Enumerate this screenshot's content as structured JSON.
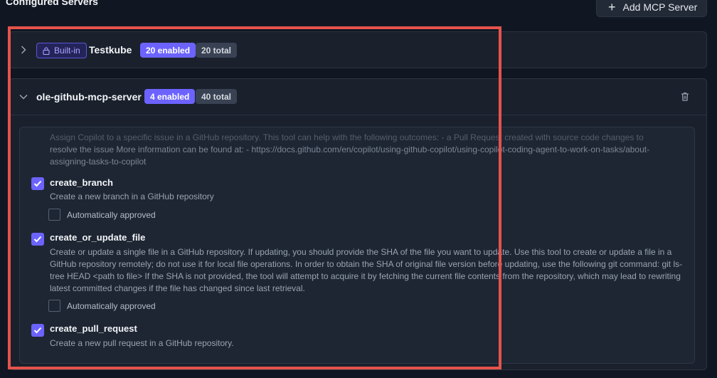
{
  "header": {
    "title": "Configured Servers",
    "add_button_label": "Add MCP Server"
  },
  "servers": [
    {
      "builtin_label": "Built-in",
      "name": "Testkube",
      "enabled_badge": "20 enabled",
      "total_badge": "20 total",
      "expanded": false
    },
    {
      "name": "ole-github-mcp-server",
      "enabled_badge": "4 enabled",
      "total_badge": "40 total",
      "expanded": true,
      "prev_tool_description_lines": [
        "Assign Copilot to a specific issue in a GitHub repository. This tool can help with the following outcomes: - a Pull Request created with source code changes to",
        "resolve the issue More information can be found at: - https://docs.github.com/en/copilot/using-github-copilot/using-copilot-coding-agent-to-work-on-tasks/about-",
        "assigning-tasks-to-copilot"
      ],
      "tools": [
        {
          "name": "create_branch",
          "checked": true,
          "description": "Create a new branch in a GitHub repository",
          "auto_approved_label": "Automatically approved",
          "auto_approved": false
        },
        {
          "name": "create_or_update_file",
          "checked": true,
          "description": "Create or update a single file in a GitHub repository. If updating, you should provide the SHA of the file you want to update. Use this tool to create or update a file in a GitHub repository remotely; do not use it for local file operations. In order to obtain the SHA of original file version before updating, use the following git command: git ls-tree HEAD <path to file> If the SHA is not provided, the tool will attempt to acquire it by fetching the current file contents from the repository, which may lead to rewriting latest committed changes if the file has changed since last retrieval.",
          "auto_approved_label": "Automatically approved",
          "auto_approved": false
        },
        {
          "name": "create_pull_request",
          "checked": true,
          "description": "Create a new pull request in a GitHub repository."
        }
      ]
    }
  ],
  "colors": {
    "accent": "#6c63ff",
    "highlight": "#e5534b",
    "background": "#111722"
  },
  "icons": {
    "add": "plus-icon",
    "collapsed": "chevron-right-icon",
    "expanded": "chevron-down-icon",
    "builtin": "lock-icon",
    "delete": "trash-icon",
    "checked": "checkmark-icon"
  }
}
